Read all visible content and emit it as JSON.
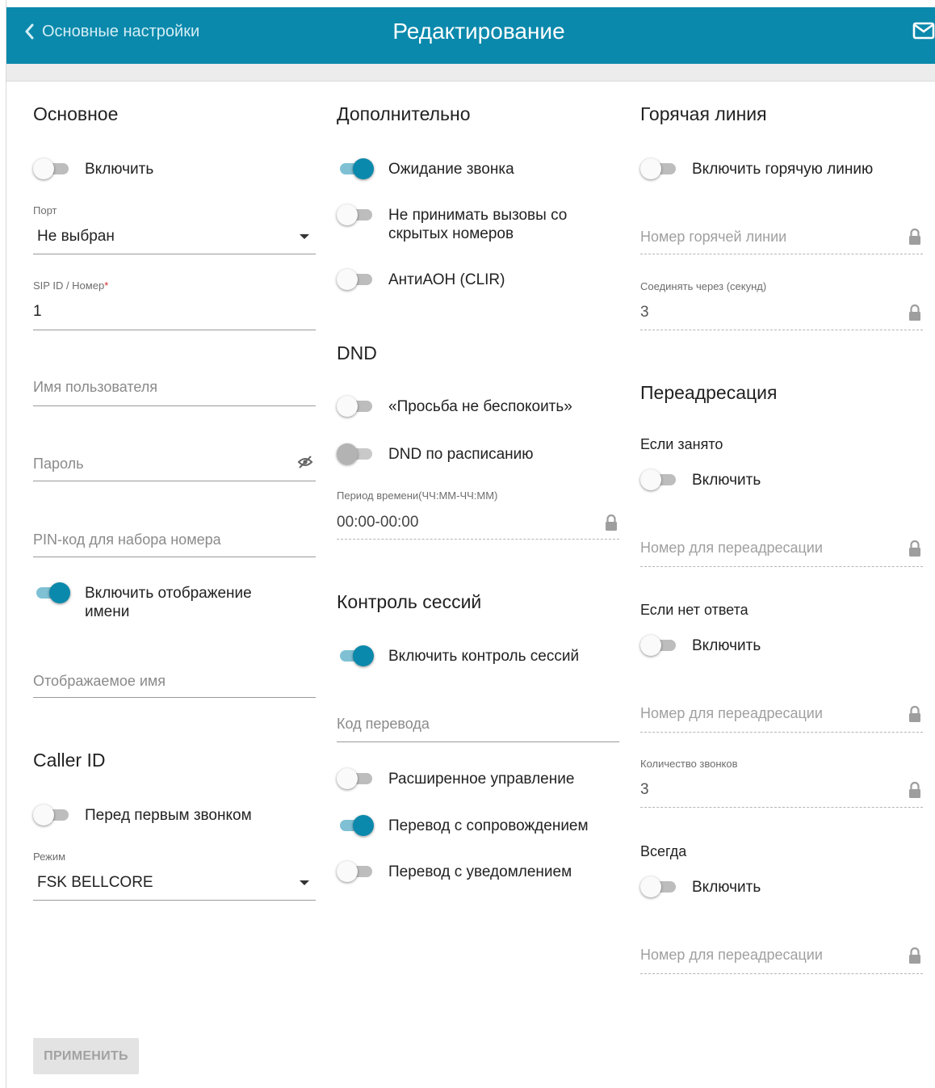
{
  "header": {
    "back_label": "Основные настройки",
    "title": "Редактирование",
    "icons": {
      "back": "chevron-left-icon",
      "mail": "mail-icon"
    }
  },
  "basic": {
    "title": "Основное",
    "enable_label": "Включить",
    "enable_on": false,
    "port": {
      "label": "Порт",
      "value": "Не выбран"
    },
    "sip": {
      "label": "SIP ID / Номер",
      "required_mark": "*",
      "value": "1"
    },
    "username_placeholder": "Имя пользователя",
    "password_placeholder": "Пароль",
    "pin_placeholder": "PIN-код для набора номера",
    "show_name_label": "Включить отображение имени",
    "show_name_on": true,
    "display_name_placeholder": "Отображаемое имя"
  },
  "caller_id": {
    "title": "Caller ID",
    "before_first_ring_label": "Перед первым звонком",
    "before_first_ring_on": false,
    "mode": {
      "label": "Режим",
      "value": "FSK BELLCORE"
    }
  },
  "additional": {
    "title": "Дополнительно",
    "call_waiting_label": "Ожидание звонка",
    "call_waiting_on": true,
    "reject_hidden_label": "Не принимать вызовы со скрытых номеров",
    "reject_hidden_on": false,
    "clir_label": "АнтиАОН (CLIR)",
    "clir_on": false
  },
  "dnd": {
    "title": "DND",
    "dnd_label": "«Просьба не беспокоить»",
    "dnd_on": false,
    "schedule_label": "DND по расписанию",
    "schedule_on": false,
    "period": {
      "label": "Период времени(ЧЧ:ММ-ЧЧ:ММ)",
      "value": "00:00-00:00"
    }
  },
  "session_control": {
    "title": "Контроль сессий",
    "enable_label": "Включить контроль сессий",
    "enable_on": true,
    "transfer_code_placeholder": "Код перевода",
    "advanced_label": "Расширенное управление",
    "advanced_on": false,
    "attended_label": "Перевод с сопровождением",
    "attended_on": true,
    "notify_label": "Перевод с уведомлением",
    "notify_on": false
  },
  "hotline": {
    "title": "Горячая линия",
    "enable_label": "Включить горячую линию",
    "enable_on": false,
    "number_placeholder": "Номер горячей линии",
    "delay": {
      "label": "Соединять через (секунд)",
      "value": "3"
    }
  },
  "forwarding": {
    "title": "Переадресация",
    "busy": {
      "title": "Если занято",
      "enable_label": "Включить",
      "enable_on": false,
      "number_placeholder": "Номер для переадресации"
    },
    "no_answer": {
      "title": "Если нет ответа",
      "enable_label": "Включить",
      "enable_on": false,
      "number_placeholder": "Номер для переадресации",
      "rings": {
        "label": "Количество звонков",
        "value": "3"
      }
    },
    "always": {
      "title": "Всегда",
      "enable_label": "Включить",
      "enable_on": false,
      "number_placeholder": "Номер для переадресации"
    }
  },
  "apply_label": "ПРИМЕНИТЬ",
  "colors": {
    "header": "#0a89ac",
    "toggle_on": "#0a89ac",
    "required": "#d32f2f"
  }
}
